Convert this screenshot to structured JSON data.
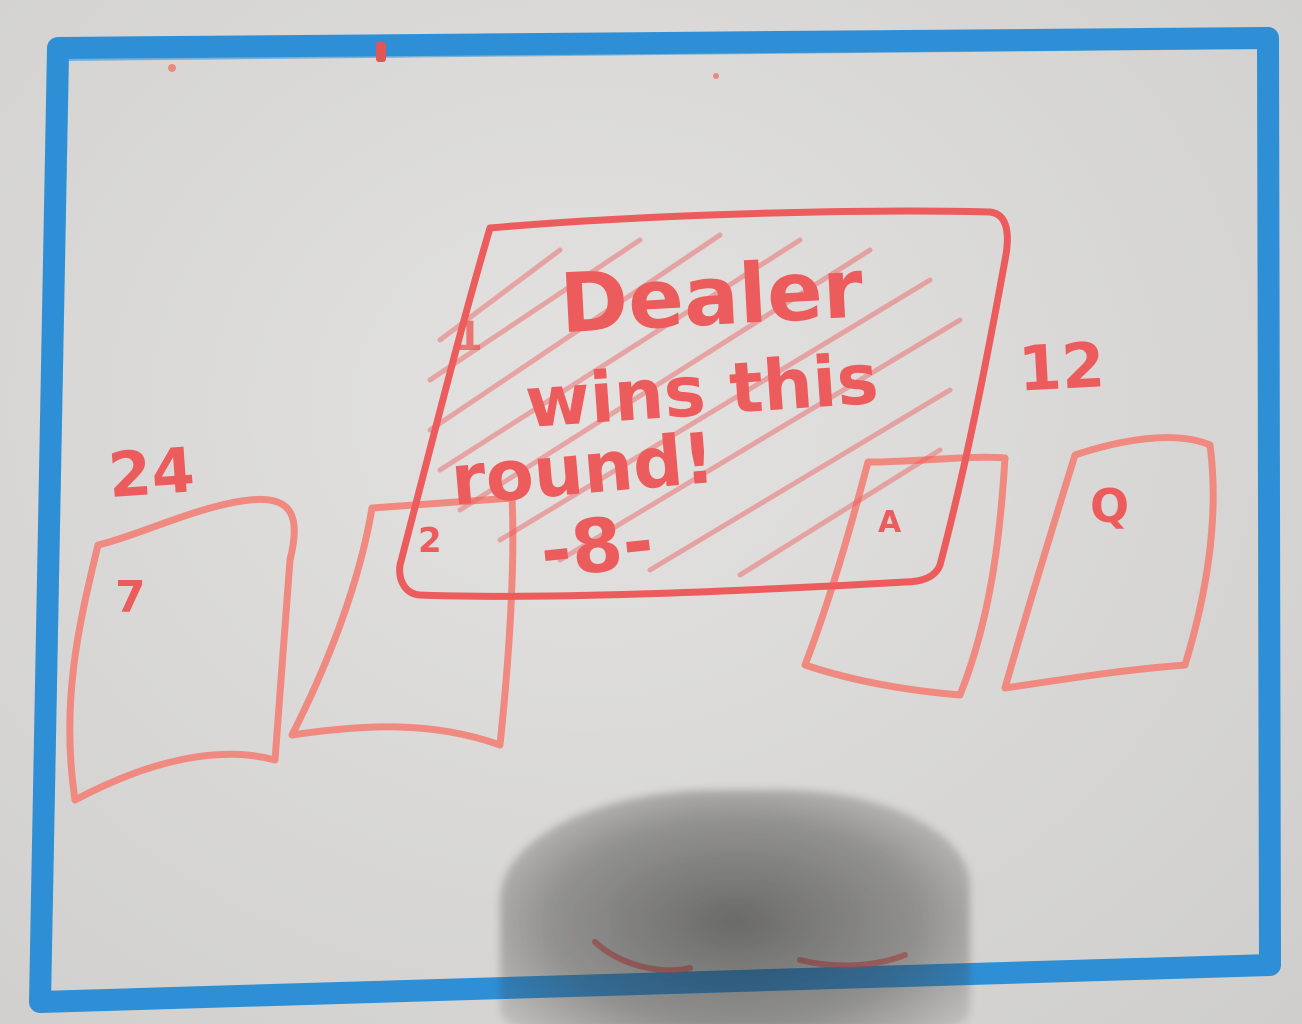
{
  "colors": {
    "frame": "#2f8fd6",
    "ink": "#ec5c5c",
    "ink_light": "#f08a80",
    "board": "#dcdbd9"
  },
  "scores": {
    "left_player": "24",
    "right_player": "12"
  },
  "cards": {
    "player_1_rank": "7",
    "player_2_rank": "Q",
    "dealer_left_rank": "2",
    "dealer_right_rank": "A"
  },
  "dialog": {
    "corner_mark": "1",
    "message_line_1": "Dealer",
    "message_line_2": "wins this",
    "message_line_3": "round!",
    "amount": "-8-"
  }
}
